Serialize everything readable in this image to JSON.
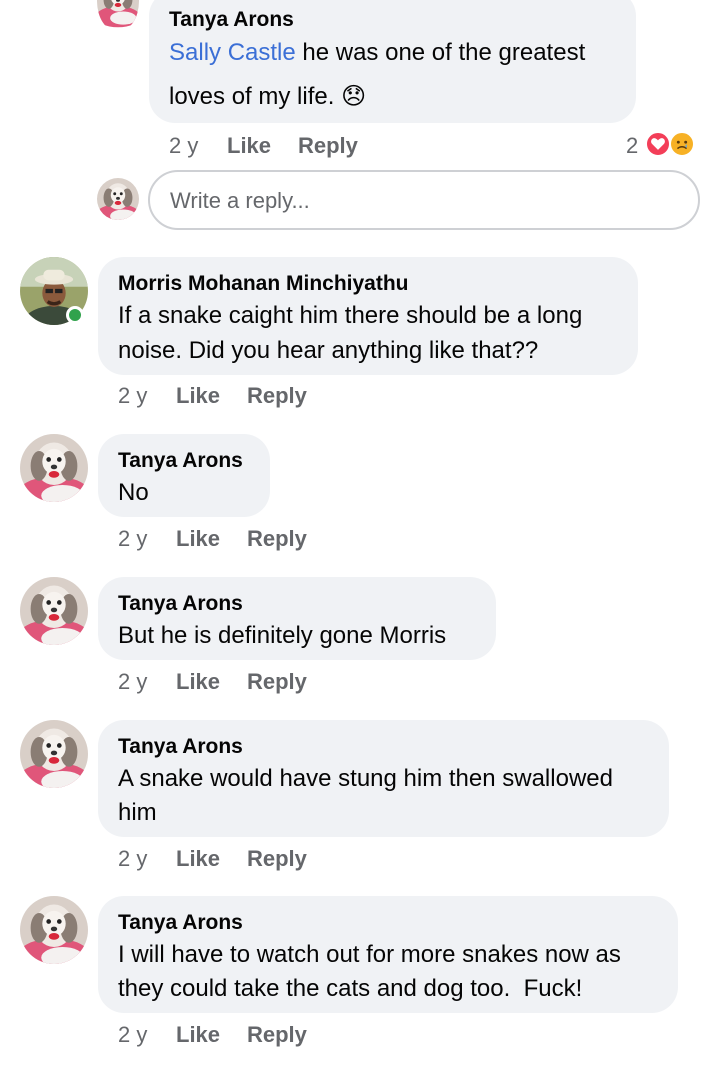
{
  "comments": [
    {
      "author": "Tanya Arons",
      "mention": "Sally Castle",
      "text_line1": " he was one of the greatest",
      "text_line2": "loves of my life. ",
      "emoji": "😞",
      "time": "2 y",
      "like": "Like",
      "reply": "Reply",
      "reaction_count": "2"
    },
    {
      "author": "Morris Mohanan Minchiyathu",
      "text_line1": "If a snake caight him there should be a long",
      "text_line2": "noise. Did you hear anything like that??",
      "time": "2 y",
      "like": "Like",
      "reply": "Reply"
    },
    {
      "author": "Tanya Arons",
      "text_line1": "No",
      "time": "2 y",
      "like": "Like",
      "reply": "Reply"
    },
    {
      "author": "Tanya Arons",
      "text_line1": "But he is definitely gone Morris",
      "time": "2 y",
      "like": "Like",
      "reply": "Reply"
    },
    {
      "author": "Tanya Arons",
      "text_line1": "A snake would have stung him then swallowed",
      "text_line2": "him",
      "time": "2 y",
      "like": "Like",
      "reply": "Reply"
    },
    {
      "author": "Tanya Arons",
      "text_line1": "I will have to watch out for more snakes now as",
      "text_line2": "they could take the cats and dog too.  Fuck!",
      "time": "2 y",
      "like": "Like",
      "reply": "Reply"
    }
  ],
  "reply_box": {
    "placeholder": "Write a reply..."
  },
  "colors": {
    "bubble": "#f0f2f5",
    "meta": "#65676b",
    "mention": "#3b6fd6",
    "online": "#31a24c",
    "love": "#f33e58",
    "sad": "#f7b125"
  },
  "icons": {
    "reaction_love": "heart-reaction-icon",
    "reaction_sad": "sad-reaction-icon"
  }
}
